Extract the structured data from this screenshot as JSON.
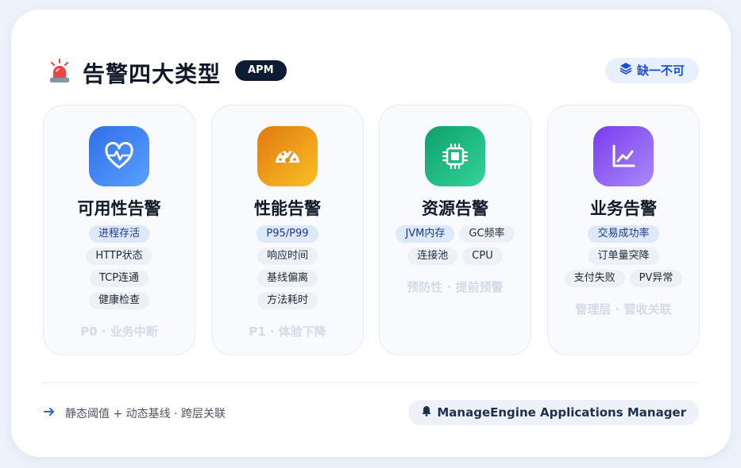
{
  "header": {
    "title": "告警四大类型",
    "badge": "APM",
    "right_badge": "缺一不可",
    "siren_icon": "siren-icon",
    "layers_icon": "layers-icon"
  },
  "columns": [
    {
      "icon": "heart-pulse-icon",
      "icon_gradient": [
        "#2f6fe8",
        "#5aa0ff"
      ],
      "title": "可用性告警",
      "tags": [
        "进程存活",
        "HTTP状态",
        "TCP连通",
        "健康检查"
      ],
      "highlight": "进程存活",
      "footer": "P0 · 业务中断"
    },
    {
      "icon": "gauge-icon",
      "icon_gradient": [
        "#e07a10",
        "#fbbf24"
      ],
      "title": "性能告警",
      "tags": [
        "P95/P99",
        "响应时间",
        "基线偏离",
        "方法耗时"
      ],
      "highlight": "P95/P99",
      "footer": "P1 · 体验下降"
    },
    {
      "icon": "cpu-chip-icon",
      "icon_gradient": [
        "#0e9f6e",
        "#34d399"
      ],
      "title": "资源告警",
      "tags": [
        "JVM内存",
        "GC频率",
        "连接池",
        "CPU"
      ],
      "highlight": "JVM内存",
      "footer": "预防性 · 提前预警"
    },
    {
      "icon": "line-chart-icon",
      "icon_gradient": [
        "#7c3aed",
        "#a78bfa"
      ],
      "title": "业务告警",
      "tags": [
        "交易成功率",
        "订单量突降",
        "支付失败",
        "PV异常"
      ],
      "highlight": "交易成功率",
      "footer": "管理层 · 营收关联"
    }
  ],
  "footer": {
    "left_text": "静态阈值 + 动态基线 · 跨层关联",
    "right_text": "ManageEngine Applications Manager",
    "arrow_icon": "arrow-right-icon",
    "bell_icon": "bell-icon"
  },
  "colors": {
    "accent": "#2563eb",
    "badge_dark": "#0f1b33",
    "tag_highlight": "#dde8f8",
    "tag_default": "#edf1f6",
    "footer_muted": "#d3dbe7"
  }
}
